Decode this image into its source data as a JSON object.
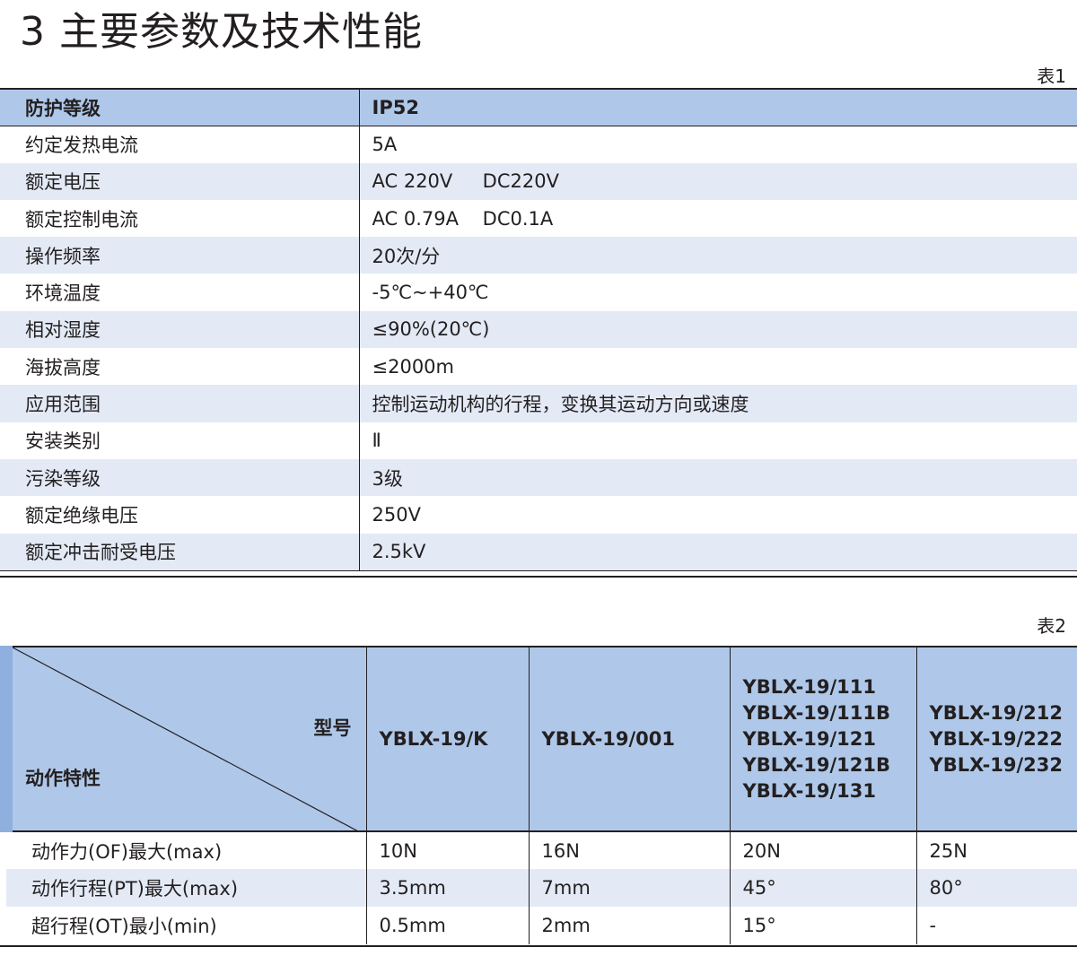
{
  "title": "3 主要参数及技术性能",
  "table1": {
    "label": "表1",
    "header": [
      "防护等级",
      "IP52"
    ],
    "rows": [
      [
        "约定发热电流",
        "5A"
      ],
      [
        "额定电压",
        "AC 220V     DC220V"
      ],
      [
        "额定控制电流",
        "AC 0.79A    DC0.1A"
      ],
      [
        "操作频率",
        "20次/分"
      ],
      [
        "环境温度",
        "-5℃~+40℃"
      ],
      [
        "相对湿度",
        "≤90%(20℃)"
      ],
      [
        "海拔高度",
        "≤2000m"
      ],
      [
        "应用范围",
        "控制运动机构的行程，变换其运动方向或速度"
      ],
      [
        "安装类别",
        "Ⅱ"
      ],
      [
        "污染等级",
        "3级"
      ],
      [
        "额定绝缘电压",
        "250V"
      ],
      [
        "额定冲击耐受电压",
        "2.5kV"
      ]
    ]
  },
  "table2": {
    "label": "表2",
    "diag_top": "型号",
    "diag_bottom": "动作特性",
    "models": [
      [
        "YBLX-19/K"
      ],
      [
        "YBLX-19/001"
      ],
      [
        "YBLX-19/111",
        "YBLX-19/111B",
        "YBLX-19/121",
        "YBLX-19/121B",
        "YBLX-19/131"
      ],
      [
        "YBLX-19/212",
        "YBLX-19/222",
        "YBLX-19/232"
      ]
    ],
    "rows": [
      [
        "动作力(OF)最大(max)",
        "10N",
        "16N",
        "20N",
        "25N"
      ],
      [
        "动作行程(PT)最大(max)",
        "3.5mm",
        "7mm",
        "45°",
        "80°"
      ],
      [
        "超行程(OT)最小(min)",
        "0.5mm",
        "2mm",
        "15°",
        "-"
      ]
    ]
  }
}
